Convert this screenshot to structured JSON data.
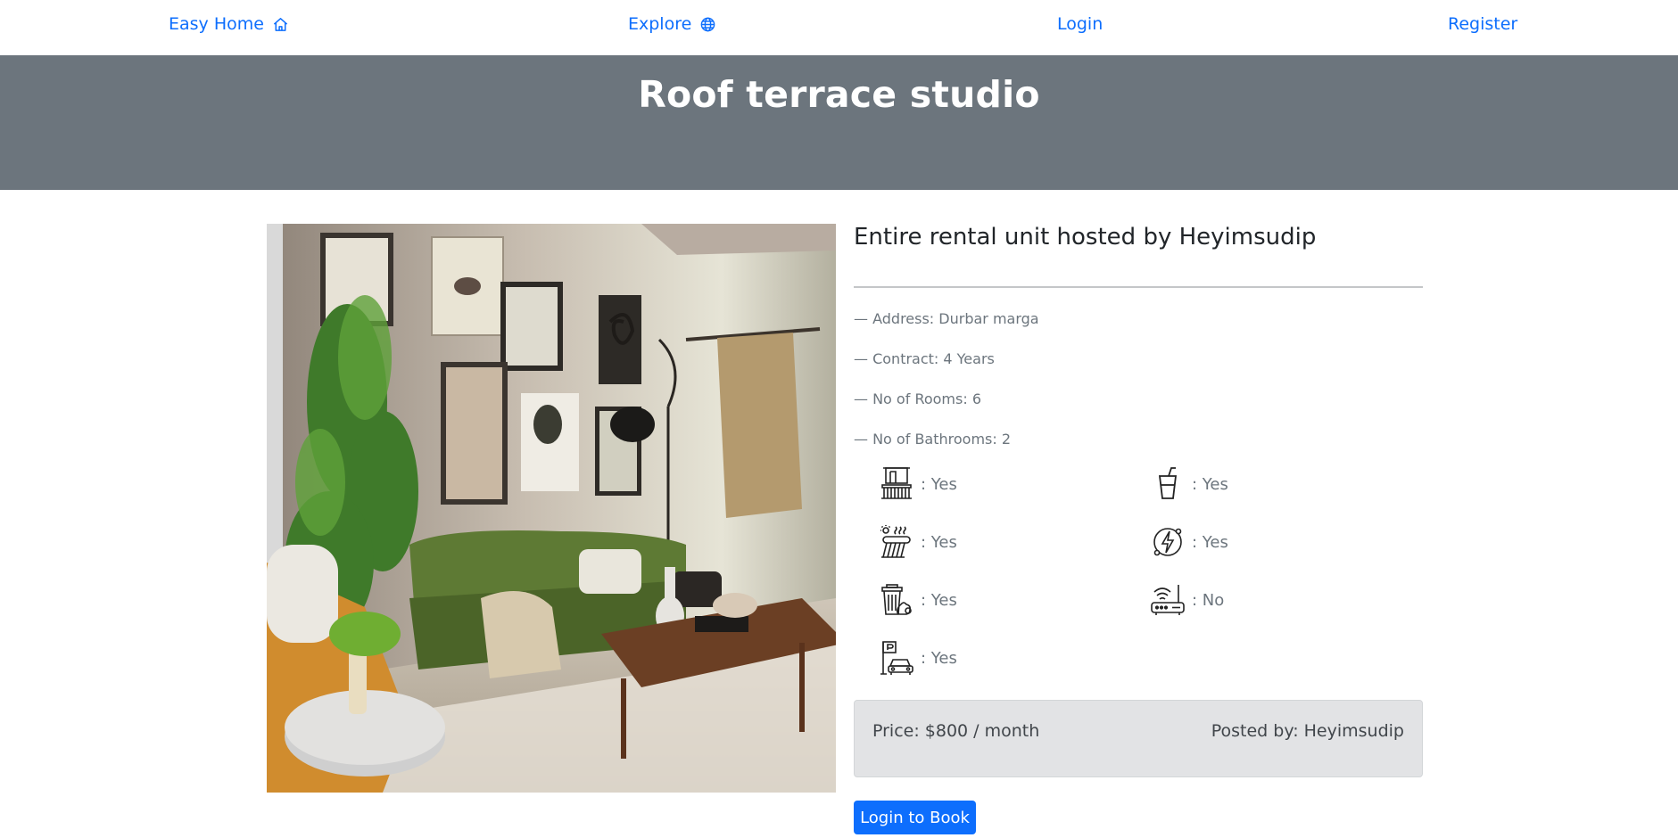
{
  "nav": {
    "brand": "Easy Home",
    "brand_icon": "house-icon",
    "explore": "Explore",
    "explore_icon": "globe-icon",
    "login": "Login",
    "register": "Register",
    "link_color": "#0d6efd"
  },
  "hero": {
    "title": "Roof terrace studio",
    "background": "#6c757d"
  },
  "listing": {
    "photo_icon": "living-room-photo",
    "heading": "Entire rental unit hosted by Heyimsudip",
    "facts": [
      "— Address: Durbar marga",
      "— Contract: 4 Years",
      "— No of Rooms: 6",
      "— No of Bathrooms: 2"
    ],
    "amenities": [
      {
        "icon": "balcony-icon",
        "value": ": Yes"
      },
      {
        "icon": "water-glass-icon",
        "value": ": Yes"
      },
      {
        "icon": "solar-water-heater-icon",
        "value": ": Yes"
      },
      {
        "icon": "electricity-icon",
        "value": ": Yes"
      },
      {
        "icon": "garbage-bin-icon",
        "value": ": Yes"
      },
      {
        "icon": "wifi-router-icon",
        "value": ": No"
      },
      {
        "icon": "parking-icon",
        "value": ": Yes"
      }
    ],
    "price": "Price: $800 / month",
    "posted_by": "Posted by: Heyimsudip",
    "book_button": "Login to Book",
    "button_color": "#0d6efd"
  }
}
